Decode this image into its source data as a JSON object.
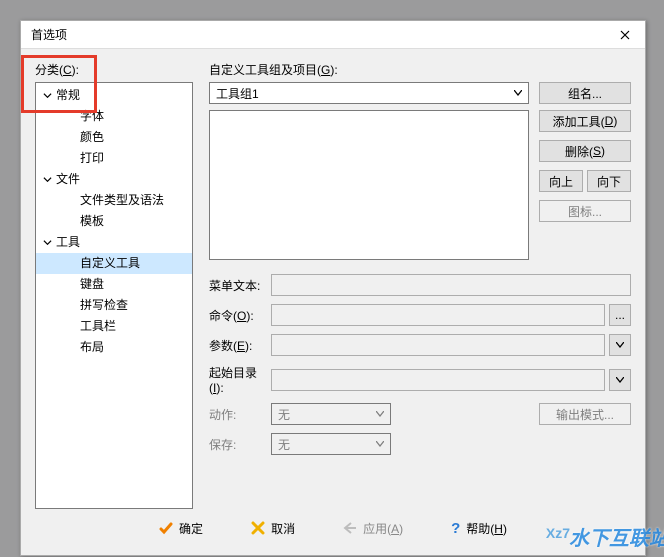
{
  "dialog": {
    "title": "首选项"
  },
  "left": {
    "category_label": "分类(",
    "category_mnemonic": "C",
    "category_label_end": "):",
    "items": [
      {
        "label": "常规",
        "type": "group"
      },
      {
        "label": "字体",
        "type": "item"
      },
      {
        "label": "颜色",
        "type": "item"
      },
      {
        "label": "打印",
        "type": "item"
      },
      {
        "label": "文件",
        "type": "group"
      },
      {
        "label": "文件类型及语法",
        "type": "item"
      },
      {
        "label": "模板",
        "type": "item"
      },
      {
        "label": "工具",
        "type": "group"
      },
      {
        "label": "自定义工具",
        "type": "item",
        "selected": true
      },
      {
        "label": "键盘",
        "type": "item"
      },
      {
        "label": "拼写检查",
        "type": "item"
      },
      {
        "label": "工具栏",
        "type": "item"
      },
      {
        "label": "布局",
        "type": "item"
      }
    ]
  },
  "right": {
    "group_label": "自定义工具组及项目(",
    "group_mnemonic": "G",
    "group_label_end": "):",
    "group_combo": "工具组1",
    "btn_name": "组名...",
    "btn_add_tool": "添加工具(",
    "btn_add_tool_m": "D",
    "btn_add_tool_end": ")",
    "btn_delete": "删除(",
    "btn_delete_m": "S",
    "btn_delete_end": ")",
    "btn_up": "向上",
    "btn_down": "向下",
    "btn_icon": "图标...",
    "menu_text_label": "菜单文本:",
    "cmd_label": "命令(",
    "cmd_m": "O",
    "cmd_end": "):",
    "param_label": "参数(",
    "param_m": "E",
    "param_end": "):",
    "initdir_label": "起始目录(",
    "initdir_m": "I",
    "initdir_end": "):",
    "action_label": "动作:",
    "action_value": "无",
    "btn_output": "输出模式...",
    "save_label": "保存:",
    "save_value": "无"
  },
  "footer": {
    "ok": "确定",
    "cancel": "取消",
    "apply": "应用(",
    "apply_m": "A",
    "apply_end": ")",
    "help": "帮助(",
    "help_m": "H",
    "help_end": ")"
  },
  "watermark": {
    "a": "Xz7",
    "b": "水下互联站"
  }
}
